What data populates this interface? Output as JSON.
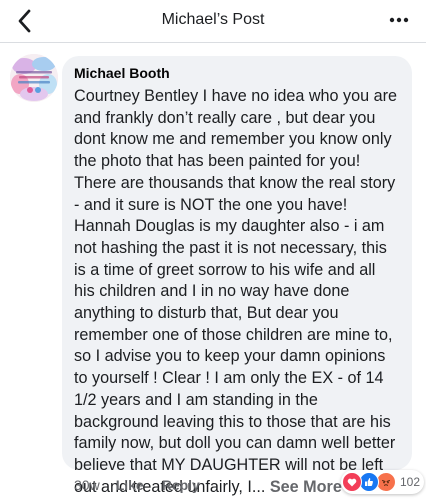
{
  "header": {
    "title": "Michael’s Post",
    "back_icon": "chevron-left-icon",
    "more_icon": "more-horizontal-icon"
  },
  "comment": {
    "author": "Michael Booth",
    "text": "Courtney Bentley I have no idea who you are and frankly don’t really care , but dear you dont know me and remember you know only the photo that has been painted for you! There are thousands that know the real story - and it sure is NOT the one you have! Hannah Douglas is my daughter also - i am not hashing the past it is not necessary, this is a time of greet sorrow to his wife and all his children and I in no way have done anything to disturb that, But dear you remember one of those children are mine to, so I advise you to keep your damn opinions to yourself ! Clear !  I am only the EX - of 14 1/2 years and I am standing in the background leaving this to those that are his family now, but doll you can damn well better believe that MY DAUGHTER will not be left out and treated unfairly, I...",
    "see_more": "See More"
  },
  "actions": {
    "time": "30w",
    "like": "Like",
    "reply": "Reply"
  },
  "reactions": {
    "types": [
      "love",
      "like",
      "angry"
    ],
    "count": "102"
  },
  "colors": {
    "bubble": "#f0f2f5",
    "muted_text": "#65676b",
    "like_blue": "#1877f2",
    "love_red": "#f33e58",
    "angry_orange": "#f7714b"
  }
}
